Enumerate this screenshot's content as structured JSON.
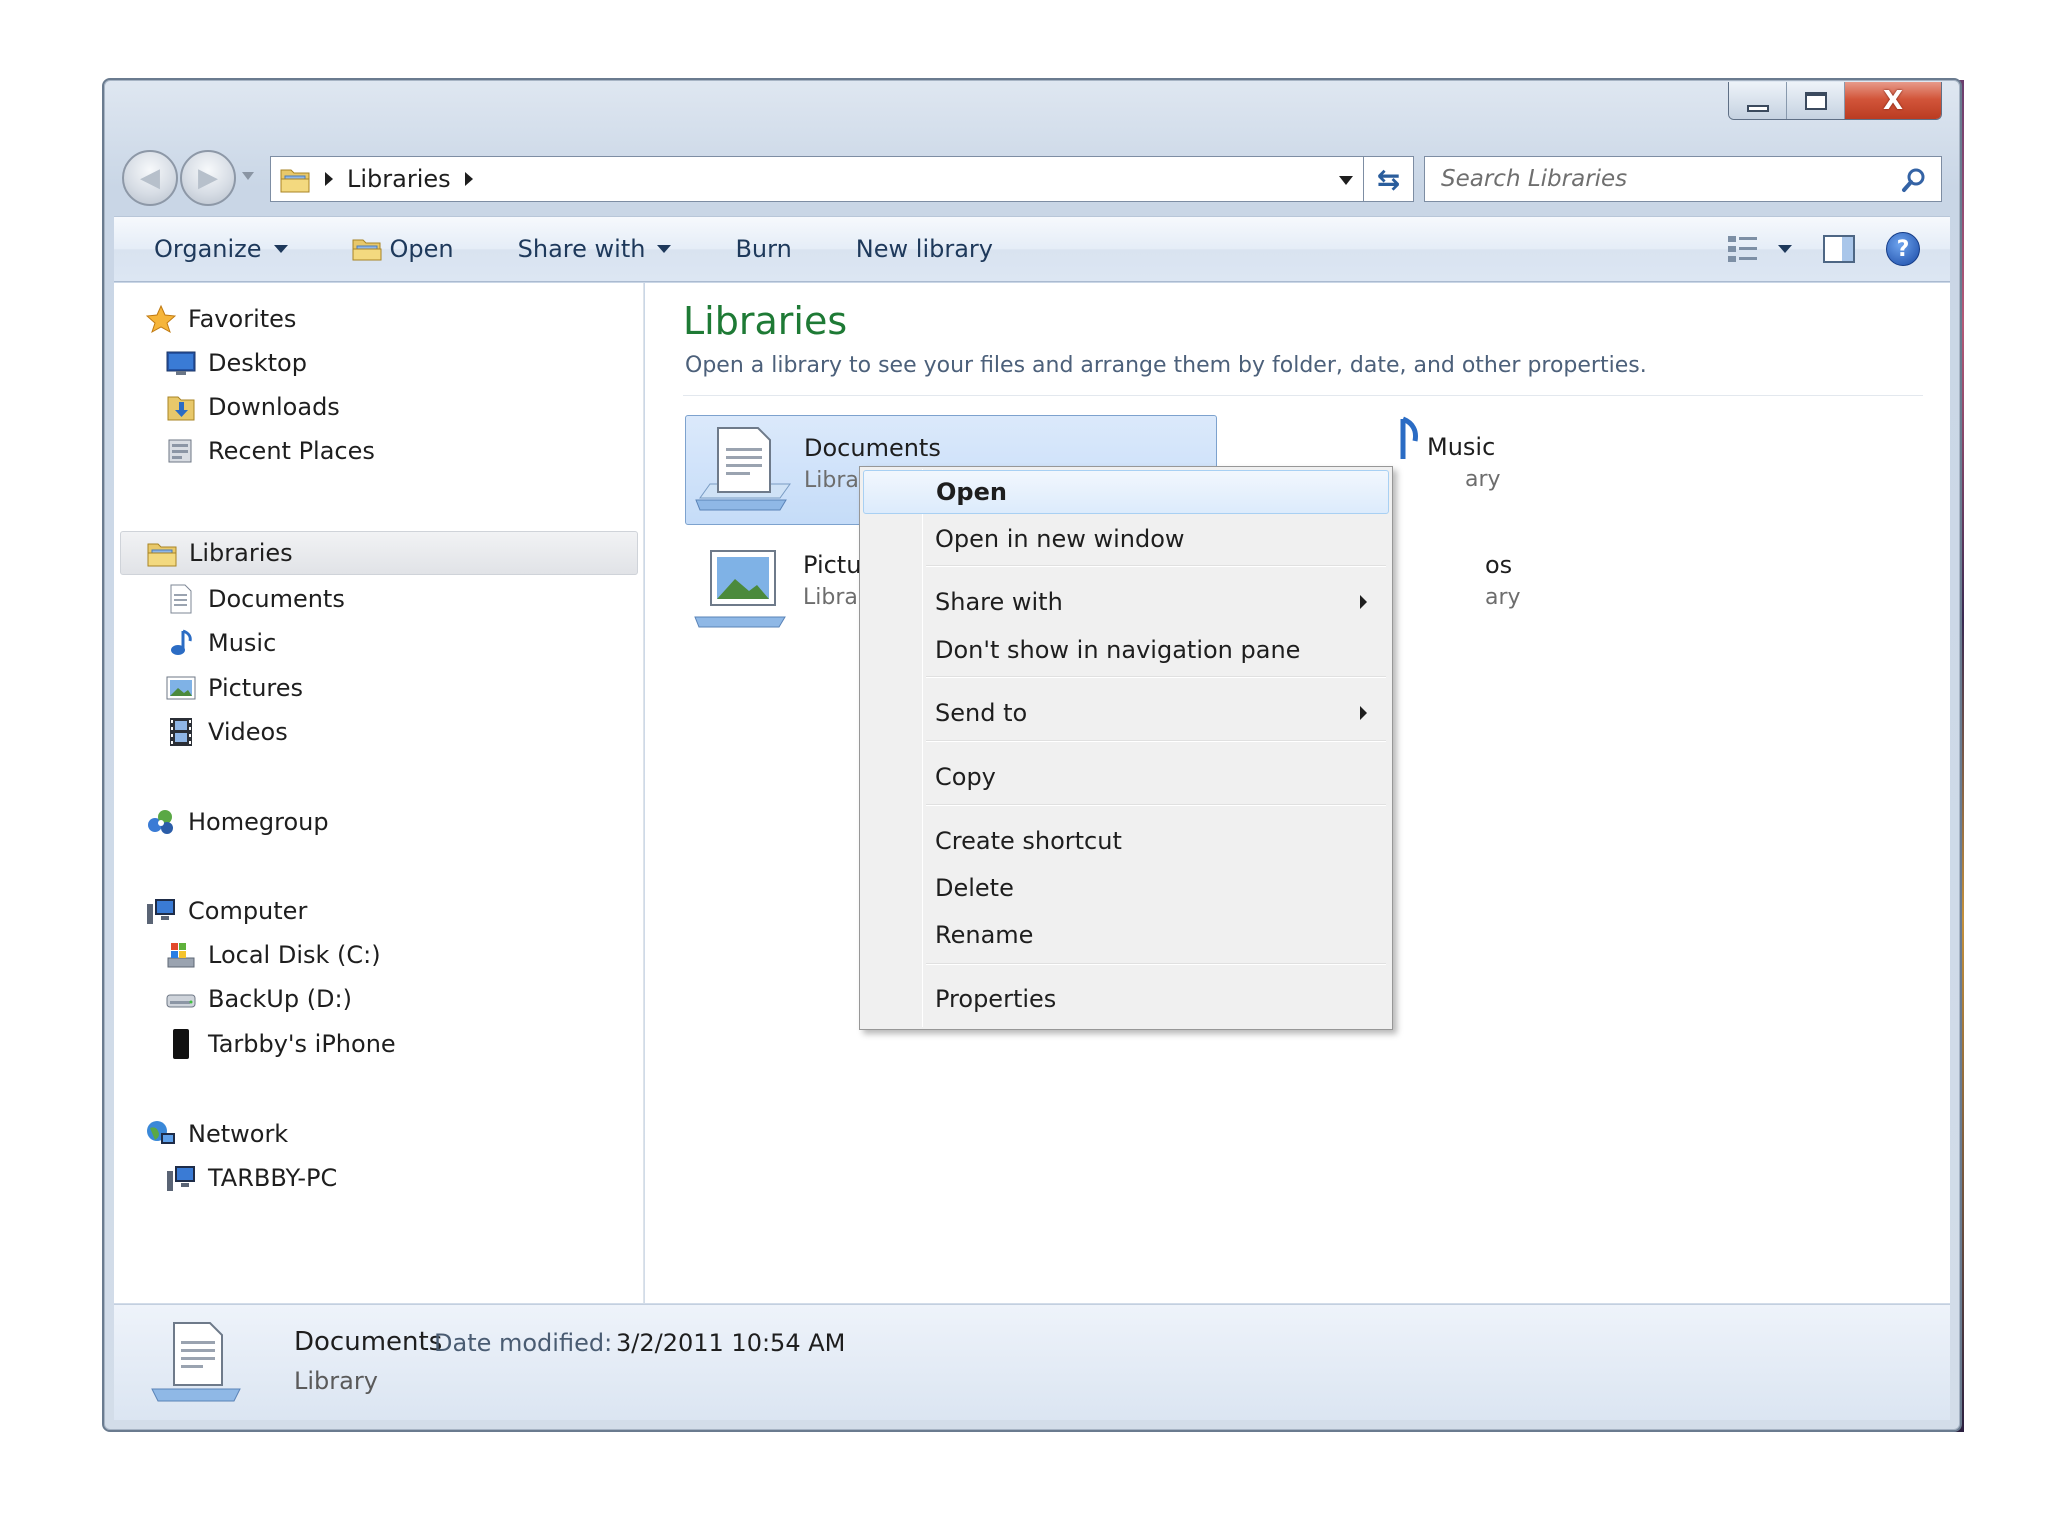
{
  "window": {
    "caption_buttons": {
      "minimize": "minimize",
      "maximize": "maximize",
      "close": "X"
    }
  },
  "address_bar": {
    "breadcrumb": "Libraries",
    "search_placeholder": "Search Libraries"
  },
  "toolbar": {
    "organize": "Organize",
    "open": "Open",
    "share_with": "Share with",
    "burn": "Burn",
    "new_library": "New library",
    "help": "?"
  },
  "nav_pane": {
    "favorites": "Favorites",
    "favorites_items": [
      "Desktop",
      "Downloads",
      "Recent Places"
    ],
    "libraries": "Libraries",
    "libraries_items": [
      "Documents",
      "Music",
      "Pictures",
      "Videos"
    ],
    "homegroup": "Homegroup",
    "computer": "Computer",
    "computer_items": [
      "Local Disk (C:)",
      "BackUp (D:)",
      "Tarbby's iPhone"
    ],
    "network": "Network",
    "network_items": [
      "TARBBY-PC"
    ]
  },
  "content": {
    "title": "Libraries",
    "subtitle": "Open a library to see your files and arrange them by folder, date, and other properties.",
    "tiles": [
      {
        "name": "Documents",
        "sub": "Libra"
      },
      {
        "name": "Music",
        "sub": "ary"
      },
      {
        "name": "Pictu",
        "sub": "Libra"
      },
      {
        "name": "os",
        "sub": "ary"
      }
    ]
  },
  "context_menu": {
    "items": [
      "Open",
      "Open in new window",
      "Share with",
      "Don't show in navigation pane",
      "Send to",
      "Copy",
      "Create shortcut",
      "Delete",
      "Rename",
      "Properties"
    ]
  },
  "details_pane": {
    "name": "Documents",
    "date_label": "Date modified:",
    "date_value": "3/2/2011 10:54 AM",
    "type": "Library"
  }
}
